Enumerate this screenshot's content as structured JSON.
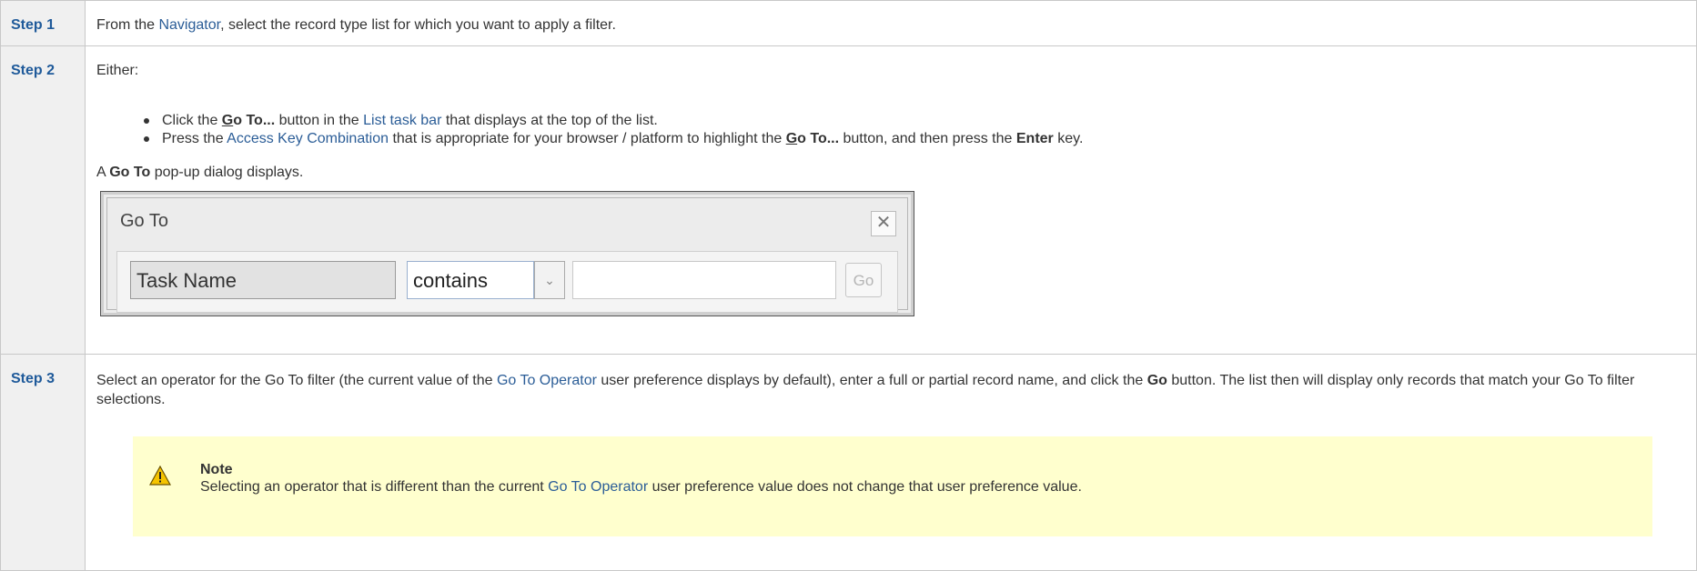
{
  "steps": [
    {
      "label": "Step 1",
      "text_before": "From the ",
      "link": "Navigator",
      "text_after": ", select the record type list for which you want to apply a filter."
    },
    {
      "label": "Step 2",
      "either": "Either:",
      "bullet1": {
        "a": "Click the ",
        "go_g": "G",
        "go_rest": "o To...",
        "b": " button in the ",
        "link": "List task bar",
        "c": " that displays at the top of the list."
      },
      "bullet2": {
        "a": "Press the ",
        "link": "Access Key Combination",
        "b": " that is appropriate for your browser / platform to highlight the ",
        "go_g": "G",
        "go_rest": "o To...",
        "c": " button, and then press the ",
        "enter": "Enter",
        "d": " key."
      },
      "popup": {
        "a": "A ",
        "bold": "Go To",
        "b": " pop-up dialog displays."
      },
      "dialog": {
        "title": "Go To",
        "close": "✕",
        "field": "Task Name",
        "operator": "contains",
        "dropdown": "⌄",
        "value": "",
        "go": "Go"
      }
    },
    {
      "label": "Step 3",
      "a": "Select an operator for the Go To filter (the current value of the ",
      "link": "Go To Operator",
      "b": " user preference displays by default), enter a full or partial record name, and click the ",
      "bold": "Go",
      "c": " button. The list then will display only records that match your Go To filter selections.",
      "note": {
        "title": "Note",
        "a": "Selecting an operator that is different than the current ",
        "link": "Go To Operator",
        "b": " user preference value does not change that user preference value.",
        "icon": "warning-icon"
      }
    }
  ]
}
